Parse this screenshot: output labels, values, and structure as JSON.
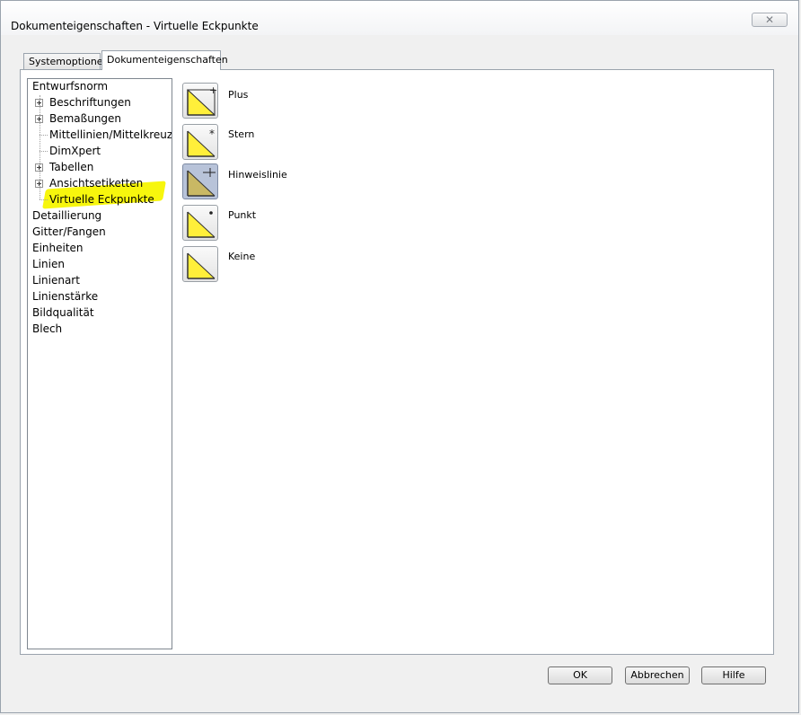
{
  "window": {
    "title": "Dokumenteigenschaften - Virtuelle Eckpunkte",
    "close_glyph": "✕"
  },
  "tabs": [
    {
      "label": "Systemoptionen",
      "selected": false
    },
    {
      "label": "Dokumenteigenschaften",
      "selected": true
    }
  ],
  "tree": {
    "items": [
      {
        "label": "Entwurfsnorm",
        "level": 0,
        "expandable": false
      },
      {
        "label": "Beschriftungen",
        "level": 1,
        "expandable": true
      },
      {
        "label": "Bemaßungen",
        "level": 1,
        "expandable": true
      },
      {
        "label": "Mittellinien/Mittelkreuze",
        "level": 1,
        "expandable": false
      },
      {
        "label": "DimXpert",
        "level": 1,
        "expandable": false
      },
      {
        "label": "Tabellen",
        "level": 1,
        "expandable": true
      },
      {
        "label": "Ansichtsetiketten",
        "level": 1,
        "expandable": true
      },
      {
        "label": "Virtuelle Eckpunkte",
        "level": 1,
        "expandable": false,
        "selected": true
      },
      {
        "label": "Detaillierung",
        "level": 0,
        "expandable": false
      },
      {
        "label": "Gitter/Fangen",
        "level": 0,
        "expandable": false
      },
      {
        "label": "Einheiten",
        "level": 0,
        "expandable": false
      },
      {
        "label": "Linien",
        "level": 0,
        "expandable": false
      },
      {
        "label": "Linienart",
        "level": 0,
        "expandable": false
      },
      {
        "label": "Linienstärke",
        "level": 0,
        "expandable": false
      },
      {
        "label": "Bildqualität",
        "level": 0,
        "expandable": false
      },
      {
        "label": "Blech",
        "level": 0,
        "expandable": false
      }
    ]
  },
  "options": [
    {
      "label": "Plus",
      "icon": "corner-plus-icon",
      "selected": false
    },
    {
      "label": "Stern",
      "icon": "corner-star-icon",
      "selected": false
    },
    {
      "label": "Hinweislinie",
      "icon": "corner-leader-icon",
      "selected": true
    },
    {
      "label": "Punkt",
      "icon": "corner-point-icon",
      "selected": false
    },
    {
      "label": "Keine",
      "icon": "corner-none-icon",
      "selected": false
    }
  ],
  "buttons": {
    "ok": "OK",
    "cancel": "Abbrechen",
    "help": "Hilfe"
  },
  "colors": {
    "highlight": "#f7f600",
    "icon_fill": "#ffef3a",
    "selected_option": "#b8c3d9"
  }
}
